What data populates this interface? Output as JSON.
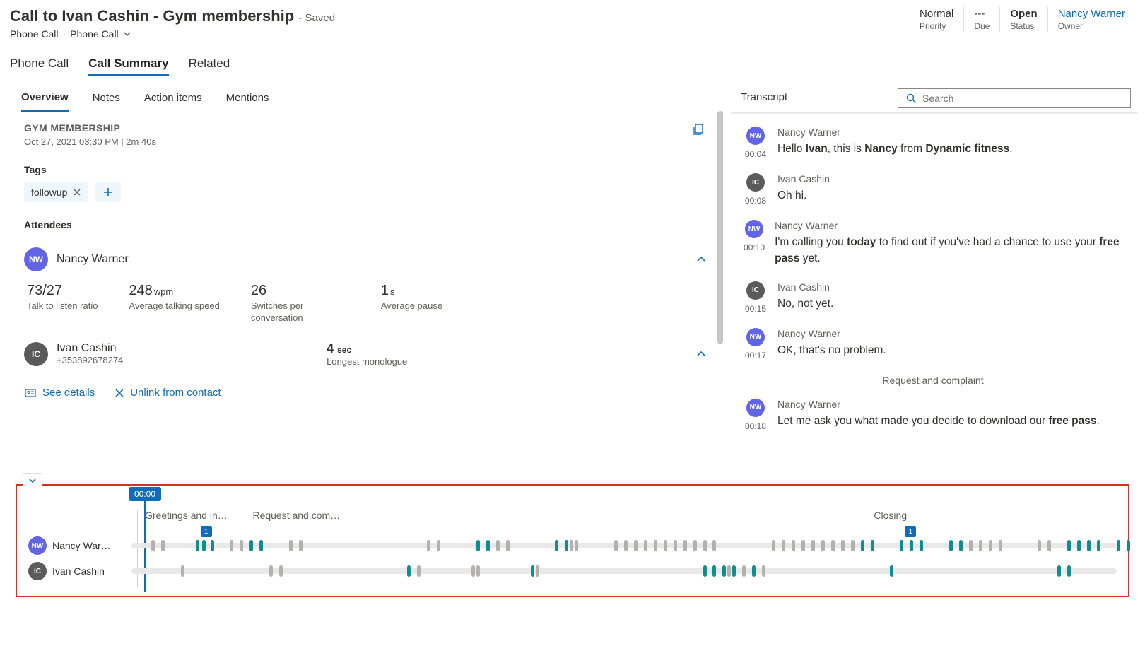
{
  "header": {
    "title": "Call to Ivan Cashin - Gym membership",
    "saved_suffix": " - Saved",
    "breadcrumb1": "Phone Call",
    "breadcrumb2": "Phone Call",
    "priority_val": "Normal",
    "priority_lbl": "Priority",
    "due_val": "---",
    "due_lbl": "Due",
    "status_val": "Open",
    "status_lbl": "Status",
    "owner_val": "Nancy Warner",
    "owner_lbl": "Owner"
  },
  "main_tabs": {
    "tab1": "Phone Call",
    "tab2": "Call Summary",
    "tab3": "Related"
  },
  "sub_tabs": {
    "t1": "Overview",
    "t2": "Notes",
    "t3": "Action items",
    "t4": "Mentions"
  },
  "overview": {
    "title": "GYM MEMBERSHIP",
    "meta": "Oct 27, 2021 03:30 PM  |  2m 40s",
    "tags_label": "Tags",
    "tag1": "followup",
    "attendees_label": "Attendees",
    "att1_name": "Nancy Warner",
    "stats": {
      "s1_val": "73/27",
      "s1_lbl": "Talk to listen ratio",
      "s2_val": "248",
      "s2_unit": "wpm",
      "s2_lbl": "Average talking speed",
      "s3_val": "26",
      "s3_lbl": "Switches per conversation",
      "s4_val": "1",
      "s4_unit": "s",
      "s4_lbl": "Average pause"
    },
    "att2_name": "Ivan Cashin",
    "att2_phone": "+353892678274",
    "mono_val": "4",
    "mono_unit": "sec",
    "mono_lbl": "Longest monologue",
    "see_details": "See details",
    "unlink": "Unlink from contact"
  },
  "transcript": {
    "header": "Transcript",
    "search_placeholder": "Search",
    "turns": [
      {
        "avatar": "NW",
        "ts": "00:04",
        "speaker": "Nancy Warner",
        "html": "Hello <b>Ivan</b>, this is <b>Nancy</b> from <b>Dynamic fitness</b>."
      },
      {
        "avatar": "IC",
        "ts": "00:08",
        "speaker": "Ivan Cashin",
        "html": "Oh hi."
      },
      {
        "avatar": "NW",
        "ts": "00:10",
        "speaker": "Nancy Warner",
        "html": "I'm calling you <b>today</b> to find out if you've had a chance to use your <b>free pass</b> yet."
      },
      {
        "avatar": "IC",
        "ts": "00:15",
        "speaker": "Ivan Cashin",
        "html": "No, not yet."
      },
      {
        "avatar": "NW",
        "ts": "00:17",
        "speaker": "Nancy Warner",
        "html": "OK, that's no problem."
      }
    ],
    "divider": "Request and complaint",
    "turn_after": {
      "avatar": "NW",
      "ts": "00:18",
      "speaker": "Nancy Warner",
      "html": "Let me ask you what made you decide to download our <b>free pass</b>."
    }
  },
  "timeline": {
    "marker_time": "00:00",
    "seg1": "Greetings and in…",
    "seg2": "Request and com…",
    "seg3": "Closing",
    "speaker1": "Nancy War…",
    "speaker2": "Ivan Cashin",
    "badge1": "1",
    "badge2": "1",
    "track1": {
      "grey": [
        2,
        3,
        10,
        11,
        16,
        17,
        30,
        31,
        37,
        38,
        44.5,
        45,
        49,
        50,
        51,
        52,
        53,
        54,
        55,
        56,
        57,
        58,
        59,
        65,
        66,
        67,
        68,
        69,
        70,
        71,
        72,
        73,
        85,
        86,
        87,
        88,
        92,
        93
      ],
      "teal": [
        6.5,
        7.2,
        8,
        12,
        13,
        35,
        36,
        43,
        44,
        74,
        75,
        78,
        79,
        80,
        83,
        84,
        95,
        96,
        97,
        98,
        100,
        101
      ]
    },
    "track2": {
      "grey": [
        5,
        14,
        15,
        29,
        34.5,
        35,
        41,
        60.5,
        62,
        64
      ],
      "teal": [
        28,
        40.5,
        58,
        59,
        60,
        61,
        63,
        77,
        94,
        95,
        103
      ]
    }
  }
}
